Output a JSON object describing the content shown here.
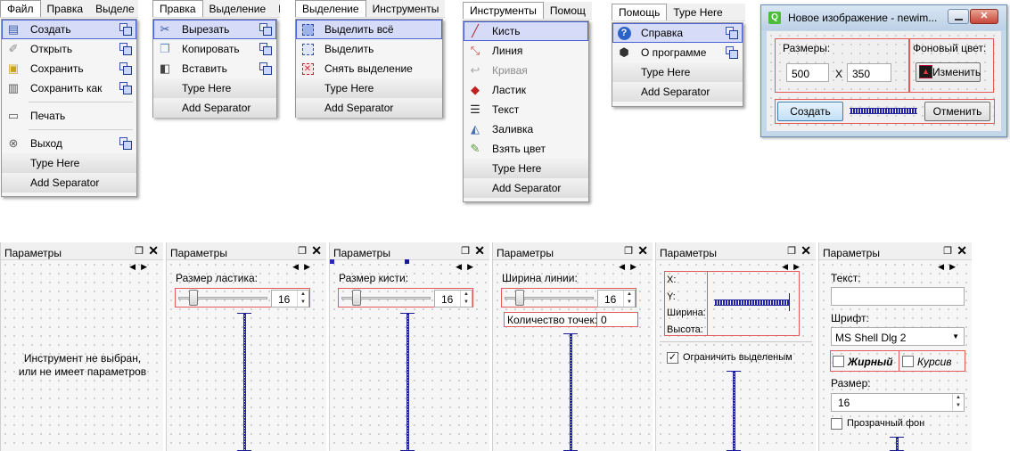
{
  "menus": {
    "file": {
      "bar": [
        "Файл",
        "Правка",
        "Выделе"
      ],
      "items": [
        "Создать",
        "Открыть",
        "Сохранить",
        "Сохранить как",
        "Печать",
        "Выход"
      ],
      "type_here": "Type Here",
      "add_sep": "Add Separator"
    },
    "edit": {
      "bar": [
        "Правка",
        "Выделение",
        "I"
      ],
      "items": [
        "Вырезать",
        "Копировать",
        "Вставить"
      ],
      "type_here": "Type Here",
      "add_sep": "Add Separator"
    },
    "select": {
      "bar": [
        "Выделение",
        "Инструменты"
      ],
      "items": [
        "Выделить всё",
        "Выделить",
        "Снять выделение"
      ],
      "type_here": "Type Here",
      "add_sep": "Add Separator"
    },
    "tools": {
      "bar": [
        "Инструменты",
        "Помощ"
      ],
      "items": [
        "Кисть",
        "Линия",
        "Кривая",
        "Ластик",
        "Текст",
        "Заливка",
        "Взять цвет"
      ],
      "type_here": "Type Here",
      "add_sep": "Add Separator"
    },
    "help": {
      "bar": [
        "Помощь",
        "Type Here"
      ],
      "items": [
        "Справка",
        "О программе"
      ],
      "type_here": "Type Here",
      "add_sep": "Add Separator"
    }
  },
  "dialog": {
    "title": "Новое изображение - newim...",
    "size_label": "Размеры:",
    "width": "500",
    "x_label": "X",
    "height": "350",
    "bg_label": "Фоновый цвет:",
    "change_btn": "Изменить",
    "create_btn": "Создать",
    "cancel_btn": "Отменить"
  },
  "docks": {
    "title": "Параметры",
    "none": {
      "line1": "Инструмент не выбран,",
      "line2": "или не имеет параметров"
    },
    "eraser": {
      "label": "Размер ластика:",
      "value": "16"
    },
    "brush": {
      "label": "Размер кисти:",
      "value": "16"
    },
    "line": {
      "label": "Ширина линии:",
      "value": "16",
      "points_label": "Количество точек:",
      "points_value": "0"
    },
    "select": {
      "x": "X:",
      "y": "Y:",
      "w": "Ширина:",
      "h": "Высота:",
      "constrain": "Ограничить выделеным"
    },
    "text": {
      "text_label": "Текст:",
      "font_label": "Шрифт:",
      "font_value": "MS Shell Dlg 2",
      "bold": "Жирный",
      "italic": "Курсив",
      "size_label": "Размер:",
      "size_value": "16",
      "transparent": "Прозрачный фон"
    }
  }
}
